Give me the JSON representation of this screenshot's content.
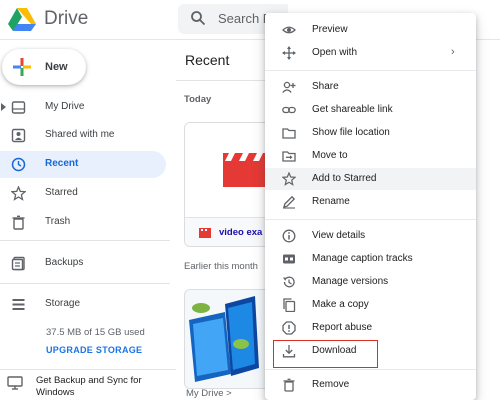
{
  "header": {
    "app_name": "Drive",
    "search_placeholder": "Search D"
  },
  "sidebar": {
    "new_label": "New",
    "items": [
      {
        "label": "My Drive",
        "icon": "my-drive-icon"
      },
      {
        "label": "Shared with me",
        "icon": "shared-icon"
      },
      {
        "label": "Recent",
        "icon": "clock-icon",
        "active": true
      },
      {
        "label": "Starred",
        "icon": "star-icon"
      },
      {
        "label": "Trash",
        "icon": "trash-icon"
      },
      {
        "label": "Backups",
        "icon": "backups-icon"
      },
      {
        "label": "Storage",
        "icon": "storage-icon"
      }
    ],
    "storage_text": "37.5 MB of 15 GB used",
    "upgrade_label": "UPGRADE STORAGE",
    "backup_banner": "Get Backup and Sync for Windows"
  },
  "main": {
    "title": "Recent",
    "groups": [
      {
        "label": "Today"
      },
      {
        "label": "Earlier this month"
      }
    ],
    "files": [
      {
        "name": "video exa"
      }
    ],
    "breadcrumb_root": "My Drive"
  },
  "context_menu": {
    "items": [
      {
        "label": "Preview",
        "icon": "eye-icon"
      },
      {
        "label": "Open with",
        "icon": "open-with-icon",
        "has_submenu": true
      },
      {
        "label": "Share",
        "icon": "add-person-icon"
      },
      {
        "label": "Get shareable link",
        "icon": "link-icon"
      },
      {
        "label": "Show file location",
        "icon": "folder-icon"
      },
      {
        "label": "Move to",
        "icon": "move-to-icon"
      },
      {
        "label": "Add to Starred",
        "icon": "star-icon"
      },
      {
        "label": "Rename",
        "icon": "pencil-icon"
      },
      {
        "label": "View details",
        "icon": "info-icon"
      },
      {
        "label": "Manage caption tracks",
        "icon": "captions-icon"
      },
      {
        "label": "Manage versions",
        "icon": "history-icon"
      },
      {
        "label": "Make a copy",
        "icon": "copy-icon"
      },
      {
        "label": "Report abuse",
        "icon": "report-icon"
      },
      {
        "label": "Download",
        "icon": "download-icon",
        "highlighted": true
      },
      {
        "label": "Remove",
        "icon": "trash-icon"
      }
    ]
  },
  "colors": {
    "accent": "#1a73e8",
    "active_nav_bg": "#e8f0fe",
    "highlight_border": "#d93025",
    "video_red": "#e53935"
  }
}
